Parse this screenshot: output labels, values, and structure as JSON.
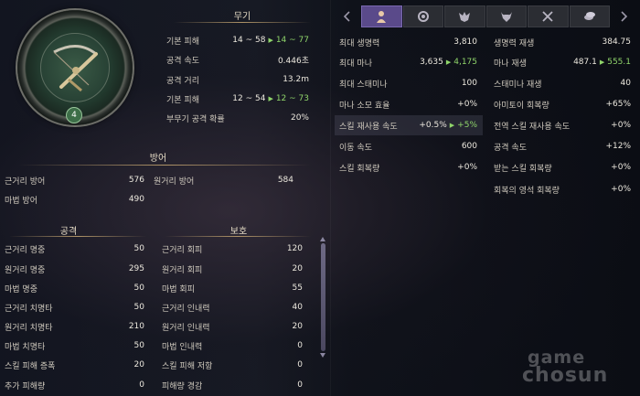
{
  "weapon": {
    "level": "4",
    "title": "무기",
    "rows": [
      {
        "label": "기본 피해",
        "from": "14 ~ 58",
        "to": "14 ~ 77"
      },
      {
        "label": "공격 속도",
        "value": "0.446초"
      },
      {
        "label": "공격 거리",
        "value": "13.2m"
      },
      {
        "label": "기본 피해",
        "from": "12 ~ 54",
        "to": "12 ~ 73"
      },
      {
        "label": "부무기 공격 확률",
        "value": "20%"
      }
    ]
  },
  "defense": {
    "title": "방어",
    "melee_label": "근거리 방어",
    "melee_value": "576",
    "ranged_label": "원거리 방어",
    "ranged_value": "584",
    "magic_label": "마법 방어",
    "magic_value": "490"
  },
  "attack": {
    "title": "공격",
    "rows": [
      {
        "label": "근거리 명중",
        "value": "50"
      },
      {
        "label": "원거리 명중",
        "value": "295"
      },
      {
        "label": "마법 명중",
        "value": "50"
      },
      {
        "label": "근거리 치명타",
        "value": "50"
      },
      {
        "label": "원거리 치명타",
        "value": "210"
      },
      {
        "label": "마법 치명타",
        "value": "50"
      },
      {
        "label": "스킬 피해 증폭",
        "value": "20"
      },
      {
        "label": "추가 피해량",
        "value": "0"
      }
    ]
  },
  "protection": {
    "title": "보호",
    "rows": [
      {
        "label": "근거리 회피",
        "value": "120"
      },
      {
        "label": "원거리 회피",
        "value": "20"
      },
      {
        "label": "마법 회피",
        "value": "55"
      },
      {
        "label": "근거리 인내력",
        "value": "40"
      },
      {
        "label": "원거리 인내력",
        "value": "20"
      },
      {
        "label": "마법 인내력",
        "value": "0"
      },
      {
        "label": "스킬 피해 저항",
        "value": "0"
      },
      {
        "label": "피해량 경감",
        "value": "0"
      }
    ]
  },
  "tabs": [
    "character-icon",
    "ring-icon",
    "wolf-icon",
    "bull-icon",
    "crossed-swords-icon",
    "coins-icon"
  ],
  "stats_left": [
    {
      "label": "최대 생명력",
      "value": "3,810"
    },
    {
      "label": "최대 마나",
      "from": "3,635",
      "to": "4,175"
    },
    {
      "label": "최대 스태미나",
      "value": "100"
    },
    {
      "label": "마나 소모 효율",
      "value": "+0%"
    },
    {
      "label": "스킬 재사용 속도",
      "from": "+0.5%",
      "to": "+5%"
    },
    {
      "label": "이동 속도",
      "value": "600"
    },
    {
      "label": "스킬 회복량",
      "value": "+0%"
    }
  ],
  "stats_right": [
    {
      "label": "생명력 재생",
      "value": "384.75"
    },
    {
      "label": "마나 재생",
      "from": "487.1",
      "to": "555.1"
    },
    {
      "label": "스태미나 재생",
      "value": "40"
    },
    {
      "label": "아미토이 회복량",
      "value": "+65%"
    },
    {
      "label": "전역 스킬 재사용 속도",
      "value": "+0%"
    },
    {
      "label": "공격 속도",
      "value": "+12%"
    },
    {
      "label": "받는 스킬 회복량",
      "value": "+0%"
    },
    {
      "label": "회복의 영석 회복량",
      "value": "+0%"
    }
  ],
  "watermark": {
    "line1": "game",
    "line2": "chosun"
  }
}
